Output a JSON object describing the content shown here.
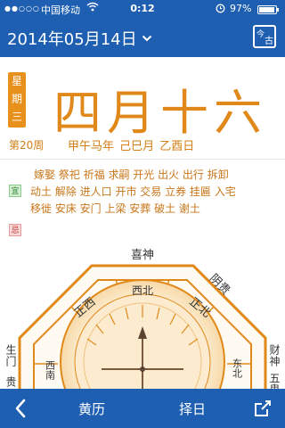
{
  "status_bar": {
    "carrier": "中国移动",
    "time": "0:12",
    "battery": "97%"
  },
  "header": {
    "date": "2014年05月14日"
  },
  "day": {
    "weekday": "星期三",
    "lunar_date": "四月十六",
    "week_number": "第20周",
    "ganzhi": "甲午马年 己巳月 乙酉日"
  },
  "almanac": {
    "yi_label": "宜",
    "ji_label": "忌",
    "yi_lines": [
      "嫁娶 祭祀 祈福 求嗣 开光 出火 出行 拆卸",
      "动土 解除 进人口 开市 交易 立券 挂匾 入宅",
      "移徙 安床 安门 上梁 安葬 破土 谢土"
    ]
  },
  "compass": {
    "outer": [
      "喜神",
      "阴贵",
      "财神",
      "五鬼",
      "生门",
      "贵"
    ],
    "inner": [
      "西北",
      "正北",
      "东北",
      "正西",
      "西南"
    ]
  },
  "tabbar": {
    "huangli": "黄历",
    "zeri": "择日"
  },
  "colors": {
    "header_blue": "#1f5fb2",
    "accent_orange": "#e0891a"
  }
}
